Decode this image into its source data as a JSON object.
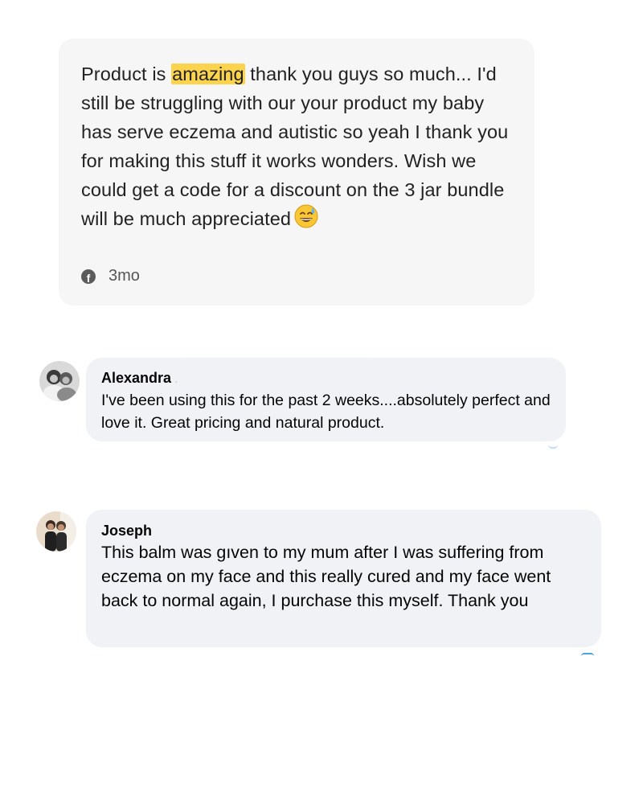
{
  "review": {
    "text_before": "Product is ",
    "highlight": "amazing",
    "text_after": " thank you guys so much... I'd still be struggling with our your product my baby has serve eczema and autistic so yeah I thank you for making this stuff it works wonders. Wish we could get a code for a discount on the 3 jar bundle will be much appreciated",
    "emoji": "grinning-face-with-sweat",
    "source_icon": "facebook-icon",
    "age": "3mo",
    "highlight_color": "#fbd34d"
  },
  "comments": [
    {
      "author": "Alexandra",
      "author_suffix": ".",
      "text": "I've been using this for the past 2 weeks....absolutely perfect and love it. Great pricing and natural product."
    },
    {
      "author": "Joseph",
      "text": "This balm was gıven to my mum after I was suffering from eczema on my face and this really cured and my face went back to normal again, I purchase this myself. Thank you"
    }
  ]
}
